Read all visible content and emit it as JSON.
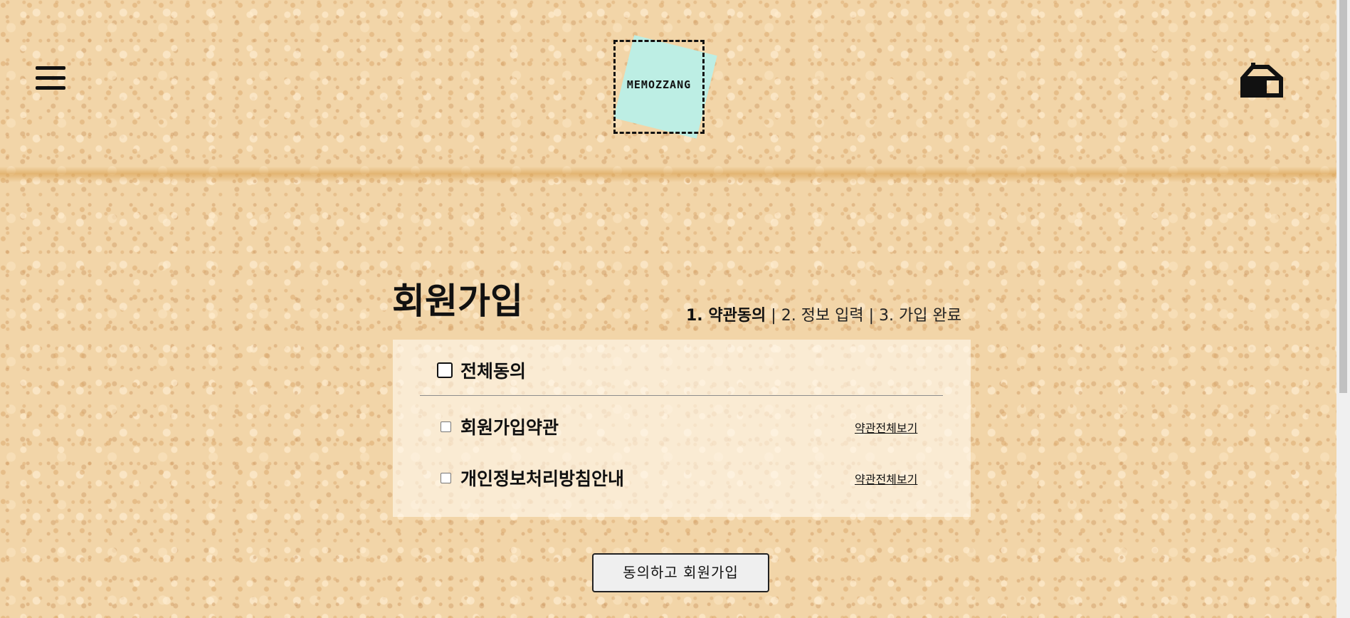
{
  "header": {
    "logo_text": "MEMOZZANG",
    "menu_icon": "hamburger-menu-icon",
    "home_icon": "home-icon"
  },
  "signup": {
    "title": "회원가입",
    "steps": {
      "step1": "1. 약관동의",
      "sep1": " | ",
      "step2": "2. 정보 입력",
      "sep2": " | ",
      "step3": "3. 가입 완료"
    },
    "agree_all_label": "전체동의",
    "terms": [
      {
        "label": "회원가입약관",
        "link": "약관전체보기"
      },
      {
        "label": "개인정보처리방침안내",
        "link": "약관전체보기"
      }
    ],
    "submit_label": "동의하고 회원가입"
  },
  "colors": {
    "cork_background": "#f2d5a8",
    "logo_note": "#bdeee4",
    "text": "#111111"
  }
}
